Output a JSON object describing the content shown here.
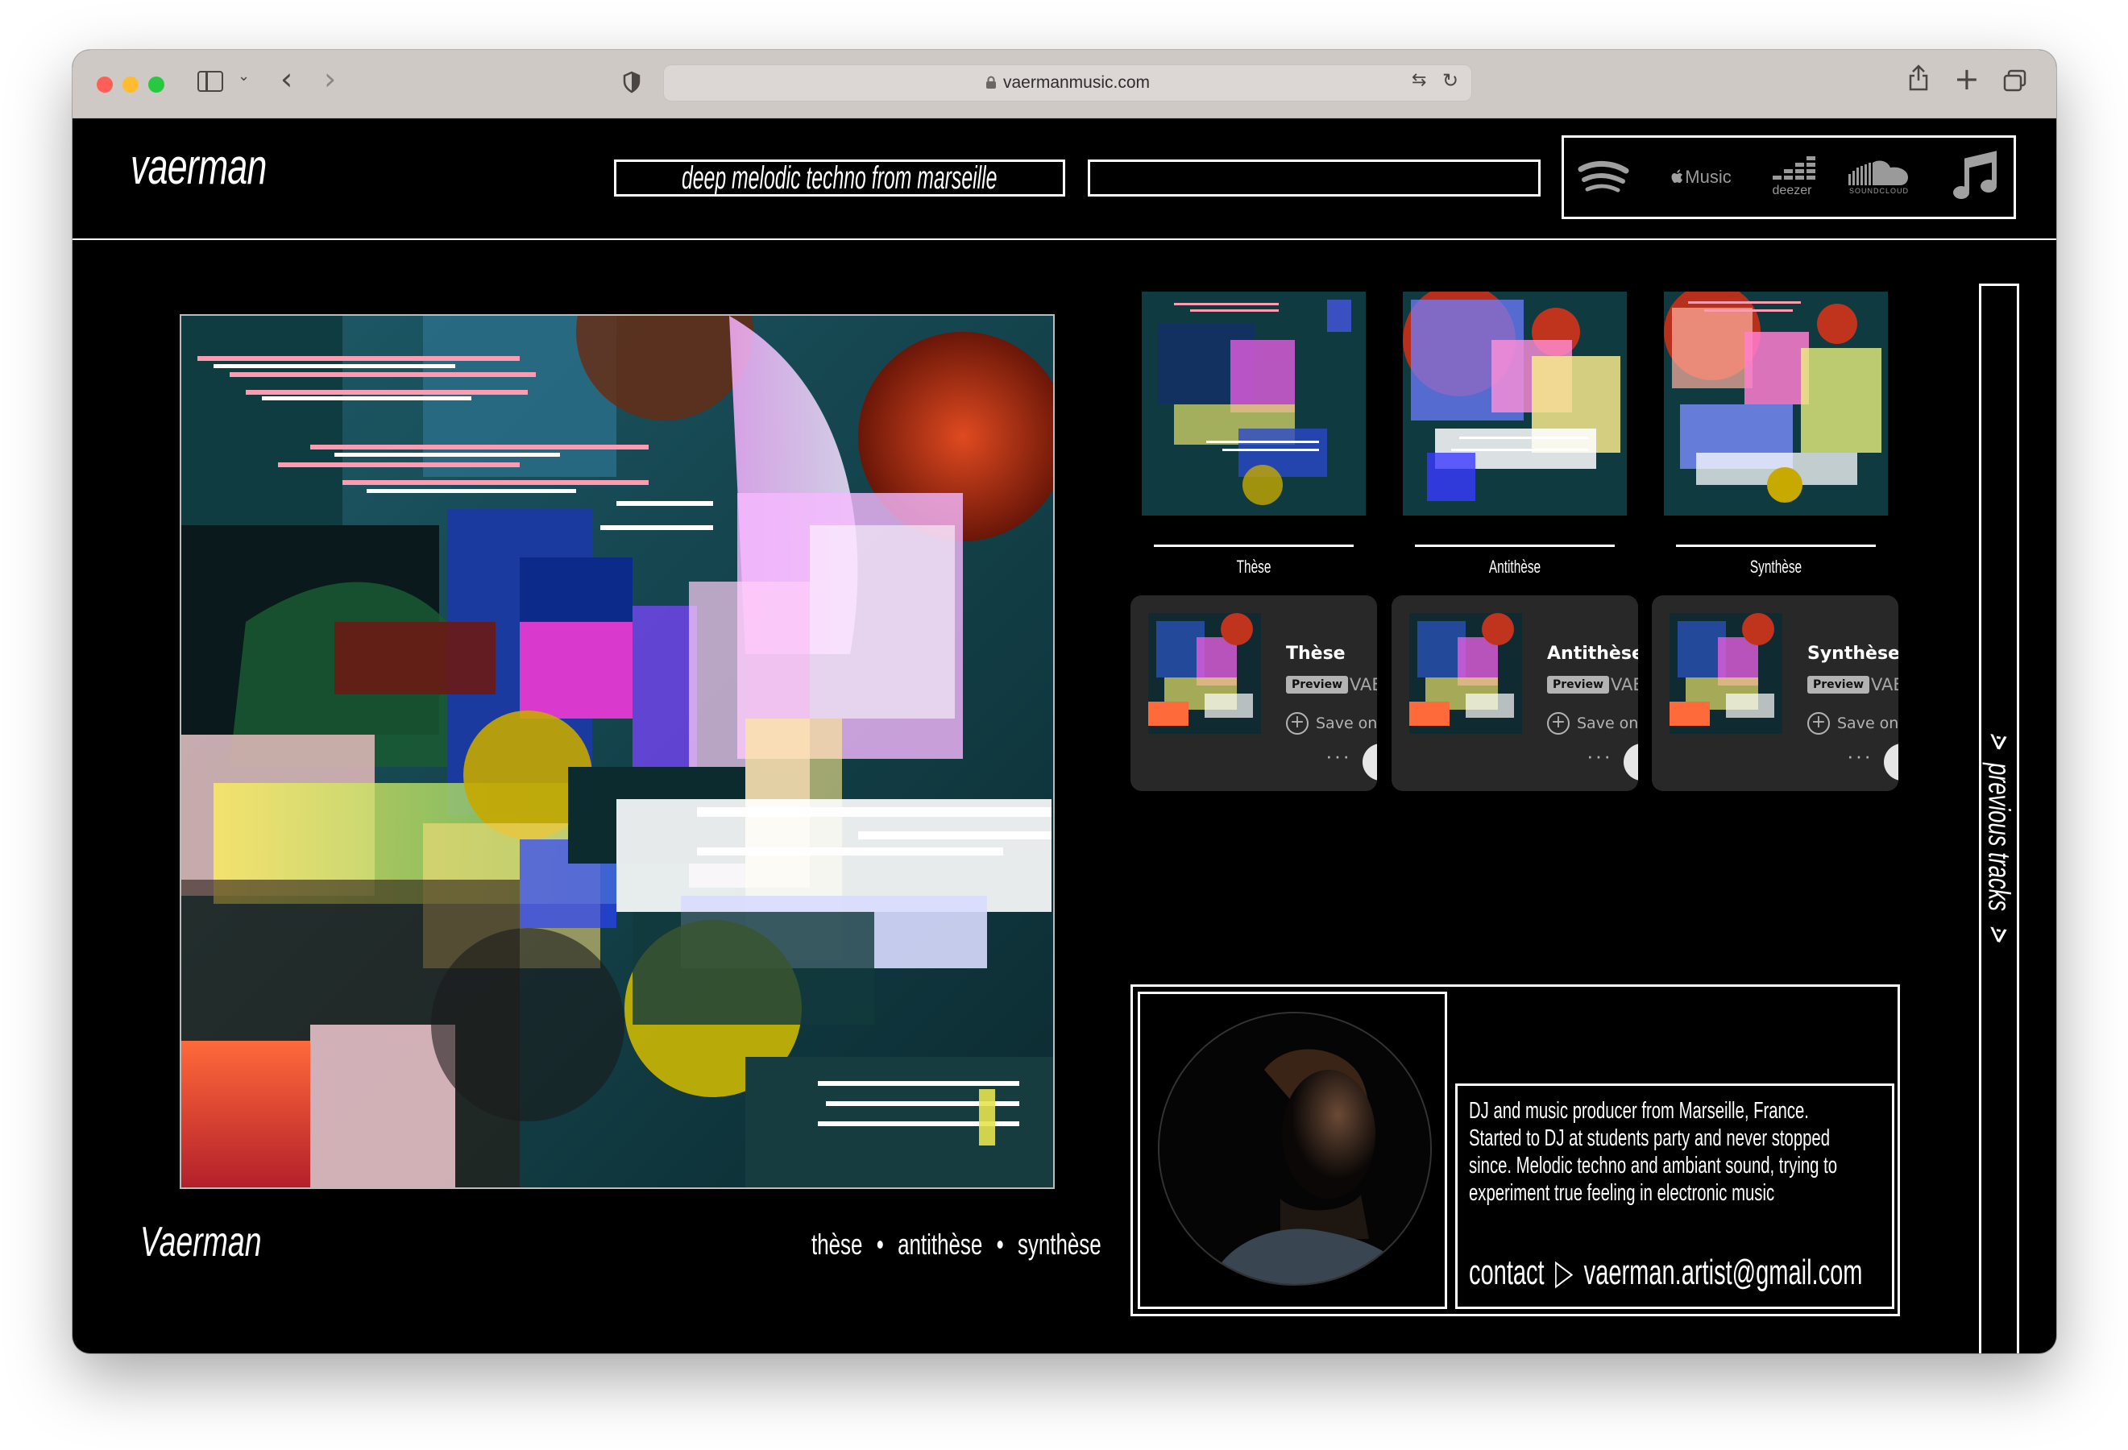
{
  "browser": {
    "url": "vaermanmusic.com",
    "icons": [
      "sidebar-icon",
      "chevron-down-icon",
      "back-icon",
      "forward-icon",
      "shield-icon",
      "lock-icon",
      "translate-icon",
      "reload-icon",
      "share-icon",
      "new-tab-icon",
      "tabs-overview-icon"
    ]
  },
  "header": {
    "logo": "vaerman",
    "tagline": "deep melodic techno from marseille",
    "streaming": [
      {
        "name": "spotify",
        "icon": "spotify-icon",
        "label": ""
      },
      {
        "name": "apple-music",
        "icon": "apple-music-icon",
        "label": "Music"
      },
      {
        "name": "deezer",
        "icon": "deezer-icon",
        "label": "deezer"
      },
      {
        "name": "soundcloud",
        "icon": "soundcloud-icon",
        "label": "SOUNDCLOUD"
      },
      {
        "name": "music",
        "icon": "music-note-icon",
        "label": ""
      }
    ]
  },
  "main": {
    "artist_signature": "Vaerman",
    "tracks_nav": [
      "thèse",
      "antithèse",
      "synthèse"
    ],
    "tracks_nav_separator": "•",
    "releases": [
      {
        "label": "Thèse"
      },
      {
        "label": "Antithèse"
      },
      {
        "label": "Synthèse"
      }
    ],
    "embeds": [
      {
        "title": "Thèse",
        "preview": "Preview",
        "artist": "VAERMAN",
        "save": "Save on Spotify",
        "more": "···"
      },
      {
        "title": "Antithèse",
        "preview": "Preview",
        "artist": "VAERMAN",
        "save": "Save on Spotify",
        "more": "···"
      },
      {
        "title": "Synthèse",
        "preview": "Preview",
        "artist": "VAERMAN",
        "save": "Save on Spotify",
        "more": "···"
      }
    ],
    "bio": "DJ and music producer from Marseille, France. Started to DJ at students party and never stopped since. Melodic techno and ambiant sound, trying to experiment true feeling in electronic music",
    "contact_label": "contact",
    "contact_arrow": "▷",
    "contact_email": "vaerman.artist@gmail.com",
    "previous_tracks": "previous tracks",
    "previous_arrow": "⋗"
  },
  "colors": {
    "background": "#000000",
    "foreground": "#ffffff",
    "embed_bg": "#282828",
    "chrome": "#cfc9c6"
  }
}
